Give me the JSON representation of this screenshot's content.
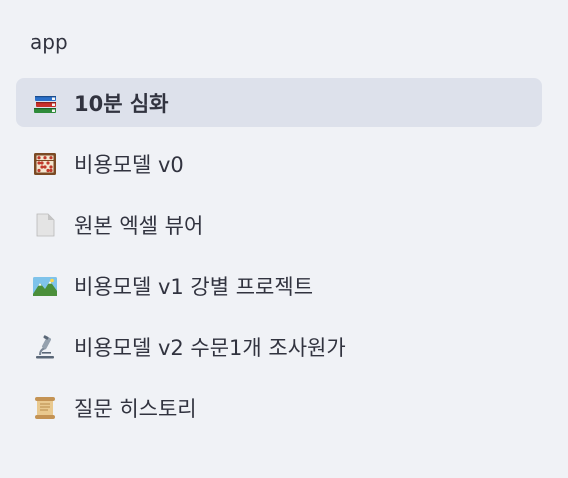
{
  "sidebar": {
    "app_label": "app",
    "items": [
      {
        "label": "10분 심화",
        "icon": "books-icon",
        "active": true
      },
      {
        "label": "비용모델 v0",
        "icon": "abacus-icon",
        "active": false
      },
      {
        "label": "원본 엑셀 뷰어",
        "icon": "document-icon",
        "active": false
      },
      {
        "label": "비용모델 v1 강별 프로젝트",
        "icon": "landscape-icon",
        "active": false
      },
      {
        "label": "비용모델 v2 수문1개 조사원가",
        "icon": "microscope-icon",
        "active": false
      },
      {
        "label": "질문 히스토리",
        "icon": "scroll-icon",
        "active": false
      }
    ]
  },
  "colors": {
    "background": "#f0f2f6",
    "active_item_bg": "#dde1eb",
    "text": "#31333f"
  }
}
